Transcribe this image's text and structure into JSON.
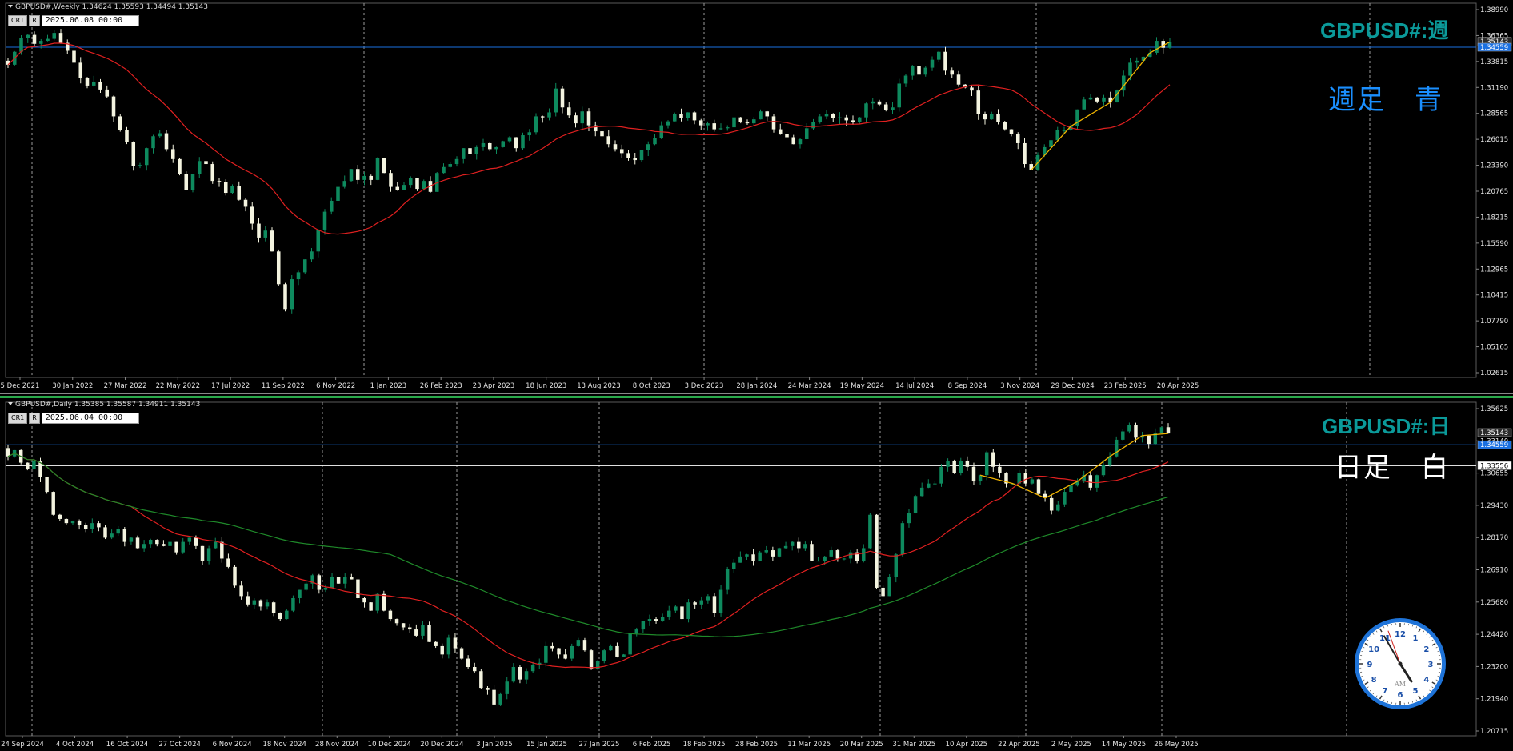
{
  "weekly": {
    "header": "GBPUSD#,Weekly  1.34624 1.35593 1.34494 1.35143",
    "toolbox": {
      "btn1": "CR1",
      "btn2": "R",
      "date": "2025.06.08 00:00"
    },
    "title": "GBPUSD#:週",
    "label": "週足　青",
    "label_color": "#1a8fff",
    "price_labels": [
      "1.38990",
      "1.36365",
      "1.33815",
      "1.31190",
      "1.28565",
      "1.26015",
      "1.23390",
      "1.20765",
      "1.18215",
      "1.15590",
      "1.12965",
      "1.10415",
      "1.07790",
      "1.05165",
      "1.02615"
    ],
    "price_range": [
      1.013,
      1.3899
    ],
    "price_tags": [
      {
        "text": "1.35143",
        "value": 1.35143,
        "color": "#2b2b2b"
      },
      {
        "text": "1.34559",
        "value": 1.34559,
        "color": "#1a6fe0"
      }
    ],
    "hline": {
      "value": 1.34559,
      "color": "#1a6fe0"
    },
    "date_labels": [
      "5 Dec 2021",
      "30 Jan 2022",
      "27 Mar 2022",
      "22 May 2022",
      "17 Jul 2022",
      "11 Sep 2022",
      "6 Nov 2022",
      "1 Jan 2023",
      "26 Feb 2023",
      "23 Apr 2023",
      "18 Jun 2023",
      "13 Aug 2023",
      "8 Oct 2023",
      "3 Dec 2023",
      "28 Jan 2024",
      "24 Mar 2024",
      "19 May 2024",
      "14 Jul 2024",
      "8 Sep 2024",
      "3 Nov 2024",
      "29 Dec 2024",
      "23 Feb 2025",
      "20 Apr 2025"
    ],
    "vgrid_positions": [
      0.04,
      0.43,
      0.86,
      1.29,
      1.72
    ],
    "closes": [
      1.328,
      1.341,
      1.355,
      1.358,
      1.349,
      1.352,
      1.354,
      1.36,
      1.35,
      1.342,
      1.33,
      1.315,
      1.307,
      1.311,
      1.303,
      1.296,
      1.276,
      1.262,
      1.25,
      1.226,
      1.227,
      1.244,
      1.256,
      1.259,
      1.243,
      1.233,
      1.218,
      1.202,
      1.218,
      1.231,
      1.228,
      1.211,
      1.21,
      1.199,
      1.206,
      1.192,
      1.185,
      1.168,
      1.154,
      1.161,
      1.14,
      1.107,
      1.082,
      1.112,
      1.119,
      1.132,
      1.14,
      1.162,
      1.18,
      1.191,
      1.205,
      1.211,
      1.223,
      1.212,
      1.216,
      1.212,
      1.234,
      1.219,
      1.205,
      1.202,
      1.207,
      1.214,
      1.203,
      1.211,
      1.2,
      1.219,
      1.225,
      1.228,
      1.233,
      1.244,
      1.238,
      1.245,
      1.249,
      1.243,
      1.245,
      1.251,
      1.255,
      1.244,
      1.257,
      1.26,
      1.276,
      1.275,
      1.28,
      1.304,
      1.285,
      1.277,
      1.269,
      1.281,
      1.267,
      1.261,
      1.256,
      1.248,
      1.243,
      1.239,
      1.234,
      1.232,
      1.242,
      1.248,
      1.254,
      1.267,
      1.271,
      1.278,
      1.274,
      1.28,
      1.272,
      1.267,
      1.269,
      1.263,
      1.264,
      1.265,
      1.275,
      1.27,
      1.269,
      1.273,
      1.281,
      1.276,
      1.263,
      1.258,
      1.255,
      1.248,
      1.253,
      1.264,
      1.27,
      1.276,
      1.278,
      1.274,
      1.275,
      1.272,
      1.27,
      1.275,
      1.289,
      1.291,
      1.288,
      1.282,
      1.285,
      1.309,
      1.317,
      1.327,
      1.318,
      1.325,
      1.333,
      1.341,
      1.322,
      1.318,
      1.308,
      1.305,
      1.302,
      1.278,
      1.273,
      1.278,
      1.27,
      1.263,
      1.258,
      1.249,
      1.228,
      1.222,
      1.237,
      1.245,
      1.252,
      1.262,
      1.262,
      1.266,
      1.283,
      1.293,
      1.295,
      1.291,
      1.295,
      1.29,
      1.302,
      1.317,
      1.33,
      1.332,
      1.336,
      1.34,
      1.352,
      1.345,
      1.351
    ]
  },
  "daily": {
    "header": "GBPUSD#,Daily  1.35385 1.35587 1.34911 1.35143",
    "toolbox": {
      "btn1": "CR1",
      "btn2": "R",
      "date": "2025.06.04 00:00"
    },
    "title": "GBPUSD#:日",
    "label": "日足　白",
    "label_color": "#ffffff",
    "price_labels": [
      "1.35625",
      "1.33140",
      "1.30655",
      "1.29430",
      "1.28170",
      "1.26910",
      "1.25680",
      "1.24420",
      "1.23200",
      "1.21940",
      "1.20715"
    ],
    "price_range": [
      1.206,
      1.366
    ],
    "price_tags": [
      {
        "text": "1.35143",
        "value": 1.35143,
        "color": "#2b2b2b"
      },
      {
        "text": "1.34559",
        "value": 1.34559,
        "color": "#1a6fe0"
      },
      {
        "text": "1.33556",
        "value": 1.33556,
        "color": "#ffffff"
      }
    ],
    "hlines": [
      {
        "value": 1.34559,
        "color": "#1a6fe0"
      },
      {
        "value": 1.33556,
        "color": "#ffffff"
      }
    ],
    "date_labels": [
      "24 Sep 2024",
      "4 Oct 2024",
      "16 Oct 2024",
      "27 Oct 2024",
      "6 Nov 2024",
      "18 Nov 2024",
      "28 Nov 2024",
      "10 Dec 2024",
      "20 Dec 2024",
      "3 Jan 2025",
      "15 Jan 2025",
      "27 Jan 2025",
      "6 Feb 2025",
      "18 Feb 2025",
      "28 Feb 2025",
      "11 Mar 2025",
      "20 Mar 2025",
      "31 Mar 2025",
      "10 Apr 2025",
      "22 Apr 2025",
      "2 May 2025",
      "14 May 2025",
      "26 May 2025"
    ],
    "closes": [
      1.34,
      1.343,
      1.337,
      1.334,
      1.338,
      1.33,
      1.323,
      1.312,
      1.31,
      1.308,
      1.309,
      1.307,
      1.305,
      1.308,
      1.306,
      1.301,
      1.303,
      1.305,
      1.299,
      1.301,
      1.296,
      1.298,
      1.3,
      1.298,
      1.297,
      1.299,
      1.294,
      1.299,
      1.301,
      1.297,
      1.29,
      1.296,
      1.299,
      1.291,
      1.287,
      1.278,
      1.273,
      1.269,
      1.271,
      1.268,
      1.27,
      1.265,
      1.262,
      1.266,
      1.272,
      1.276,
      1.279,
      1.283,
      1.276,
      1.277,
      1.282,
      1.279,
      1.282,
      1.281,
      1.272,
      1.27,
      1.266,
      1.274,
      1.266,
      1.262,
      1.26,
      1.258,
      1.257,
      1.254,
      1.259,
      1.251,
      1.249,
      1.245,
      1.253,
      1.248,
      1.243,
      1.239,
      1.237,
      1.229,
      1.228,
      1.221,
      1.226,
      1.232,
      1.239,
      1.233,
      1.237,
      1.24,
      1.241,
      1.249,
      1.248,
      1.245,
      1.243,
      1.249,
      1.252,
      1.247,
      1.238,
      1.242,
      1.247,
      1.249,
      1.244,
      1.245,
      1.255,
      1.257,
      1.261,
      1.262,
      1.261,
      1.263,
      1.266,
      1.268,
      1.262,
      1.27,
      1.269,
      1.271,
      1.273,
      1.265,
      1.276,
      1.286,
      1.289,
      1.292,
      1.293,
      1.29,
      1.294,
      1.295,
      1.292,
      1.296,
      1.297,
      1.299,
      1.296,
      1.298,
      1.29,
      1.29,
      1.292,
      1.295,
      1.291,
      1.291,
      1.294,
      1.29,
      1.296,
      1.312,
      1.277,
      1.273,
      1.282,
      1.293,
      1.308,
      1.313,
      1.321,
      1.325,
      1.327,
      1.327,
      1.335,
      1.338,
      1.332,
      1.338,
      1.335,
      1.328,
      1.331,
      1.342,
      1.335,
      1.332,
      1.327,
      1.327,
      1.332,
      1.327,
      1.329,
      1.322,
      1.32,
      1.314,
      1.317,
      1.323,
      1.326,
      1.328,
      1.331,
      1.325,
      1.331,
      1.336,
      1.34,
      1.348,
      1.352,
      1.355,
      1.349,
      1.35,
      1.346,
      1.351,
      1.354,
      1.351
    ]
  },
  "indicators": {
    "ma_fast_color": "#e02020",
    "ma_slow_color": "#1f8a2a",
    "zigzag_color": "#f0b400",
    "bull_color": "#0e8a5e",
    "bear_color": "#f4f4e0"
  },
  "clock": {
    "numerals": [
      "12",
      "1",
      "2",
      "3",
      "4",
      "5",
      "6",
      "7",
      "8",
      "9",
      "10",
      "11"
    ],
    "ampm": "AM",
    "hour": 4,
    "minute": 55
  }
}
